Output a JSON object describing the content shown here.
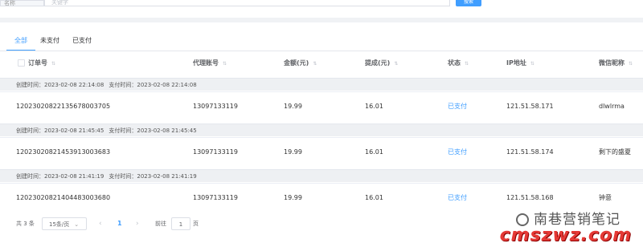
{
  "search": {
    "label": "名称",
    "placeholder": "关键字",
    "button": "搜索"
  },
  "tabs": [
    {
      "label": "全部",
      "active": true
    },
    {
      "label": "未支付",
      "active": false
    },
    {
      "label": "已支付",
      "active": false
    }
  ],
  "columns": {
    "order_no": "订单号",
    "agent": "代理账号",
    "amount": "金额(元)",
    "commission": "提成(元)",
    "status": "状态",
    "ip": "IP地址",
    "wechat": "微信昵称"
  },
  "orders": [
    {
      "created_label": "创建时间：2023-02-08 22:14:08",
      "paid_label": "支付时间：2023-02-08 22:14:08",
      "order_no": "12023020822135678003705",
      "agent": "13097133119",
      "amount": "19.99",
      "commission": "16.01",
      "status": "已支付",
      "ip": "121.51.58.171",
      "wechat": "dlwlrma"
    },
    {
      "created_label": "创建时间：2023-02-08 21:45:45",
      "paid_label": "支付时间：2023-02-08 21:45:45",
      "order_no": "12023020821453913003683",
      "agent": "13097133119",
      "amount": "19.99",
      "commission": "16.01",
      "status": "已支付",
      "ip": "121.51.58.174",
      "wechat": "剩下的盛夏"
    },
    {
      "created_label": "创建时间：2023-02-08 21:41:19",
      "paid_label": "支付时间：2023-02-08 21:41:19",
      "order_no": "12023020821404483003680",
      "agent": "13097133119",
      "amount": "19.99",
      "commission": "16.01",
      "status": "已支付",
      "ip": "121.51.58.168",
      "wechat": "钟意"
    }
  ],
  "pagination": {
    "total": "共 3 条",
    "page_size": "15条/页",
    "current_page": "1",
    "goto_label": "前往",
    "goto_value": "1",
    "page_suffix": "页"
  },
  "watermark": {
    "line1": "南巷营销笔记",
    "line2": "cmszwz.com"
  }
}
